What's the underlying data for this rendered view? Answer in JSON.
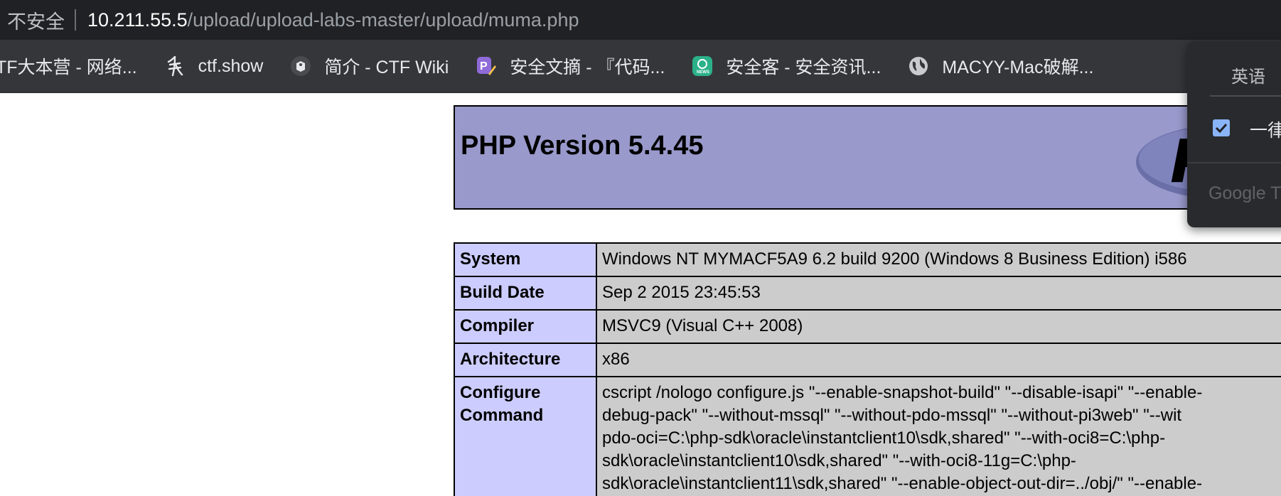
{
  "address_bar": {
    "security_label": "不安全",
    "host": "10.211.55.5",
    "path": "/upload/upload-labs-master/upload/muma.php"
  },
  "bookmarks": [
    {
      "label": "TF大本营 - 网络...",
      "icon": "none"
    },
    {
      "label": "ctf.show",
      "icon": "ctfshow-icon"
    },
    {
      "label": "简介 - CTF Wiki",
      "icon": "ctfwiki-icon"
    },
    {
      "label": "安全文摘 - 『代码...",
      "icon": "pen-icon"
    },
    {
      "label": "安全客 - 安全资讯...",
      "icon": "news-icon"
    },
    {
      "label": "MACYY-Mac破解...",
      "icon": "globe-icon"
    }
  ],
  "php": {
    "title": "PHP Version 5.4.45",
    "rows": [
      {
        "key": "System",
        "value": "Windows NT MYMACF5A9 6.2 build 9200 (Windows 8 Business Edition) i586"
      },
      {
        "key": "Build Date",
        "value": "Sep 2 2015 23:45:53"
      },
      {
        "key": "Compiler",
        "value": "MSVC9 (Visual C++ 2008)"
      },
      {
        "key": "Architecture",
        "value": "x86"
      },
      {
        "key": "Configure Command",
        "key_line1": "Configure",
        "key_line2": "Command",
        "value_lines": [
          "cscript /nologo configure.js \"--enable-snapshot-build\" \"--disable-isapi\" \"--enable-",
          "debug-pack\" \"--without-mssql\" \"--without-pdo-mssql\" \"--without-pi3web\" \"--wit",
          "pdo-oci=C:\\php-sdk\\oracle\\instantclient10\\sdk,shared\" \"--with-oci8=C:\\php-",
          "sdk\\oracle\\instantclient10\\sdk,shared\" \"--with-oci8-11g=C:\\php-",
          "sdk\\oracle\\instantclient11\\sdk,shared\" \"--enable-object-out-dir=../obj/\" \"--enable-"
        ]
      }
    ]
  },
  "translate_popup": {
    "language_tab": "英语",
    "always_translate_label": "一律",
    "always_translate_checked": true,
    "brand": "Google Tr"
  },
  "colors": {
    "php_header_bg": "#9999cc",
    "php_key_bg": "#ccccff",
    "php_value_bg": "#cccccc",
    "checkbox": "#8ab4f8"
  }
}
